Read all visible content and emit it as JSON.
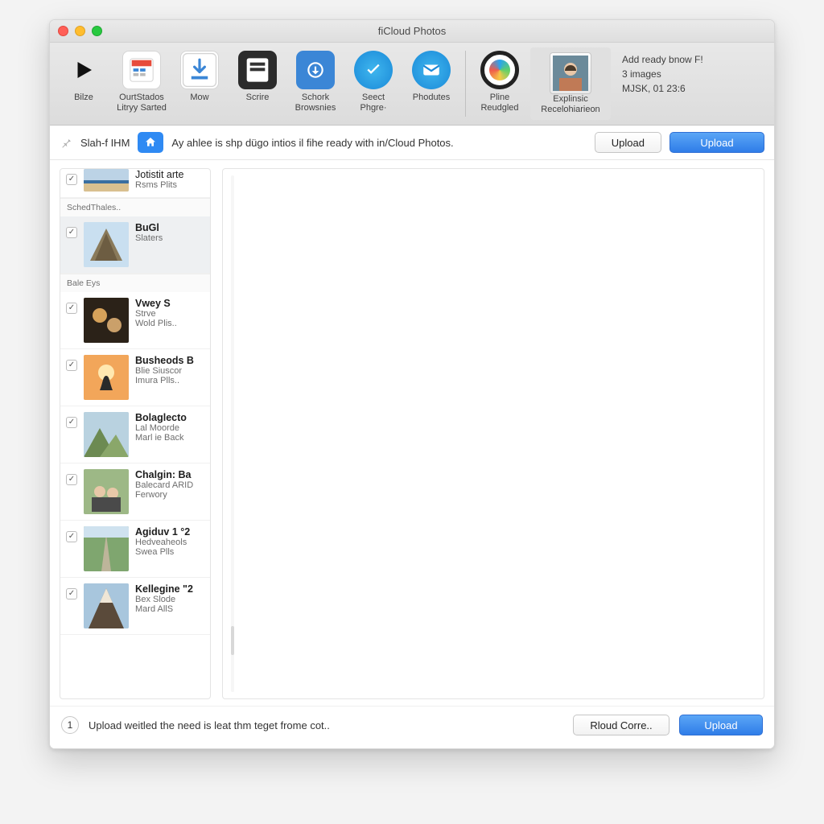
{
  "window": {
    "title": "fiCloud Photos"
  },
  "toolbar": {
    "items": [
      {
        "id": "play",
        "label": "Bilze"
      },
      {
        "id": "library",
        "label": "OurtStados Litryy Sarted"
      },
      {
        "id": "mow",
        "label": "Mow"
      },
      {
        "id": "scrire",
        "label": "Scrire"
      },
      {
        "id": "browse",
        "label": "Schork Browsnies"
      },
      {
        "id": "select",
        "label": "Seect Phgre·"
      },
      {
        "id": "phodutes",
        "label": "Phodutes"
      },
      {
        "id": "pline",
        "label": "Pline Reudgled"
      },
      {
        "id": "explain",
        "label": "Explinsic Recelohiarieon"
      }
    ],
    "status": {
      "line1": "Add ready bnow F!",
      "line2": "3 images",
      "line3": "MJSK, 01 23:6"
    }
  },
  "infobar": {
    "left_label": "Slah-f IHM",
    "message": "Ay ahlee is shp dügo intios il fihe ready with in/Cloud Photos.",
    "button_secondary": "Upload",
    "button_primary": "Upload"
  },
  "sidebar": {
    "sections": [
      {
        "header": null,
        "rows": [
          {
            "checked": true,
            "title": "Jotistit arte",
            "sub1": "Rsms Plits",
            "sub2": "",
            "half": true,
            "thumb": "beach"
          }
        ]
      },
      {
        "header": "SchedThales..",
        "rows": [
          {
            "checked": true,
            "title": "BuGl",
            "sub1": "Slaters",
            "sub2": "",
            "thumb": "temple",
            "selected": true
          }
        ]
      },
      {
        "header": "Bale Eys",
        "rows": [
          {
            "checked": true,
            "title": "Vwey S",
            "sub1": "Strve",
            "sub2": "Wold Plis..",
            "thumb": "music"
          },
          {
            "checked": true,
            "title": "Busheods B",
            "sub1": "Blie Siuscor",
            "sub2": "Imura Plls..",
            "thumb": "sunset"
          },
          {
            "checked": true,
            "title": "Bolaglecto",
            "sub1": "Lal Moorde",
            "sub2": "Marl ie Back",
            "thumb": "hills"
          },
          {
            "checked": true,
            "title": "Chalgin: Ba",
            "sub1": "Balecard ARID",
            "sub2": "Ferwory",
            "thumb": "people"
          },
          {
            "checked": true,
            "title": "Agiduv 1 °2",
            "sub1": "Hedveaheols",
            "sub2": "Swea Plls",
            "thumb": "path"
          },
          {
            "checked": true,
            "title": "Kellegine \"2",
            "sub1": "Bex Slode",
            "sub2": "Mard AllS",
            "thumb": "mountain"
          }
        ]
      }
    ]
  },
  "footer": {
    "step": "1",
    "message": "Upload weitled the need is leat thm teget frome cot..",
    "button_secondary": "Rloud Corre..",
    "button_primary": "Upload"
  }
}
